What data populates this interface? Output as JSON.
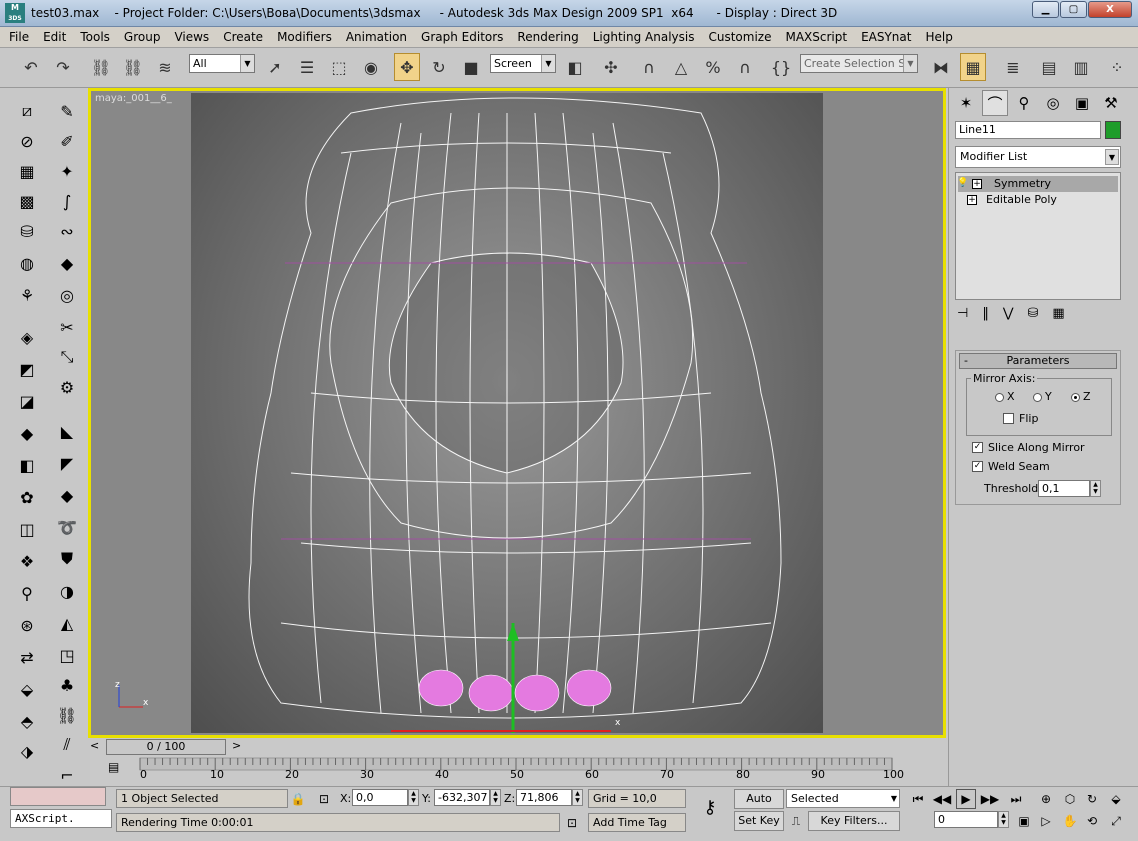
{
  "window": {
    "logo_top": "M",
    "logo_bottom": "3DS",
    "title": "test03.max    - Project Folder: C:\\Users\\Вова\\Documents\\3dsmax     - Autodesk 3ds Max Design 2009 SP1  x64      - Display : Direct 3D",
    "minimize": "▁",
    "maximize": "▢",
    "close": "X"
  },
  "menu": [
    "File",
    "Edit",
    "Tools",
    "Group",
    "Views",
    "Create",
    "Modifiers",
    "Animation",
    "Graph Editors",
    "Rendering",
    "Lighting Analysis",
    "Customize",
    "MAXScript",
    "EASYnat",
    "Help"
  ],
  "toolbar": {
    "selection_filter": "All",
    "reference_coord": "Screen",
    "named_selection_placeholder": "Create Selection Set"
  },
  "viewport": {
    "label": "maya:_001__6_",
    "axis_x": "x",
    "axis_z": "z",
    "gizmo_x": "x"
  },
  "command_panel": {
    "object_name": "Line11",
    "object_color": "#1e9c2a",
    "modifier_list": "Modifier List",
    "stack": [
      {
        "label": "Symmetry",
        "selected": true
      },
      {
        "label": "Editable Poly",
        "selected": false
      }
    ],
    "rollout_title": "Parameters",
    "mirror_axis_label": "Mirror Axis:",
    "axes": [
      "X",
      "Y",
      "Z"
    ],
    "selected_axis": "Z",
    "flip_label": "Flip",
    "slice_label": "Slice Along Mirror",
    "weld_label": "Weld Seam",
    "threshold_label": "Threshold:",
    "threshold_value": "0,1"
  },
  "timeline": {
    "frame_display": "0 / 100",
    "prev": "<",
    "next": ">",
    "ticks": [
      "0",
      "10",
      "20",
      "30",
      "40",
      "50",
      "60",
      "70",
      "80",
      "90",
      "100"
    ]
  },
  "status": {
    "maxscript": "AXScript.",
    "selection": "1 Object Selected",
    "prompt": "Rendering Time  0:00:01",
    "x_label": "X:",
    "x_value": "0,0",
    "y_label": "Y:",
    "y_value": "-632,307",
    "z_label": "Z:",
    "z_value": "71,806",
    "grid": "Grid = 10,0",
    "add_time_tag": "Add Time Tag",
    "auto_key": "Auto Key",
    "set_key": "Set Key",
    "key_mode": "Selected",
    "key_filters": "Key Filters...",
    "current_frame": "0"
  }
}
